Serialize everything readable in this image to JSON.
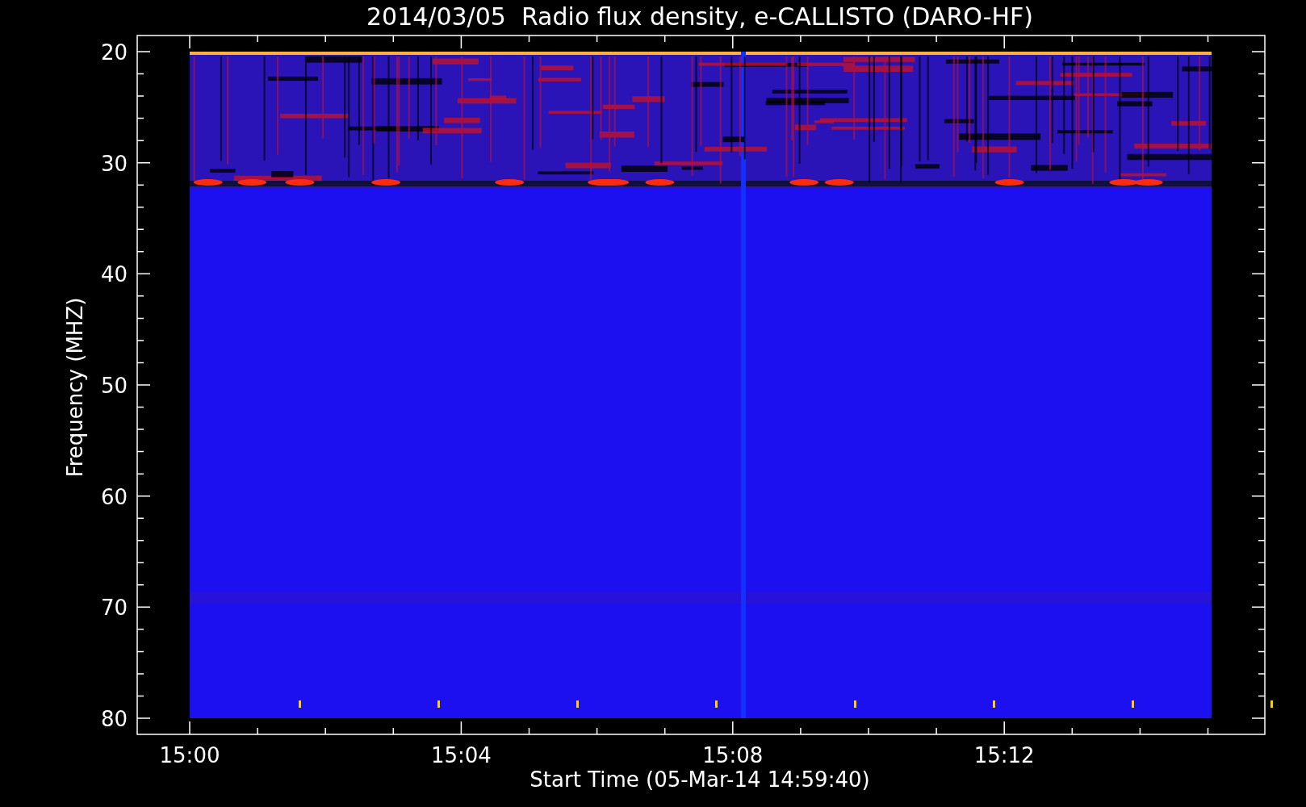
{
  "title": "2014/03/05  Radio flux density, e-CALLISTO (DARO-HF)",
  "y_axis": {
    "label": "Frequency (MHZ)",
    "ticks": [
      "20",
      "30",
      "40",
      "50",
      "60",
      "70",
      "80"
    ]
  },
  "x_axis": {
    "label": "Start Time (05-Mar-14 14:59:40)",
    "ticks": [
      "15:00",
      "15:04",
      "15:08",
      "15:12"
    ]
  }
}
